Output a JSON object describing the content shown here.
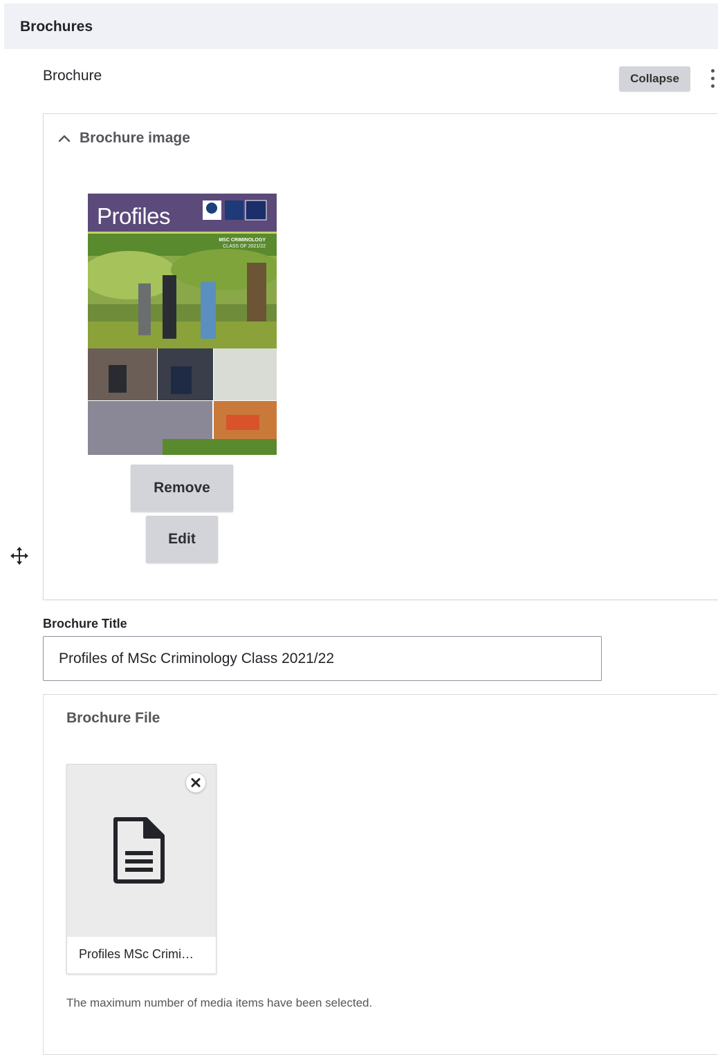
{
  "section": {
    "title": "Brochures"
  },
  "paragraph": {
    "label": "Brochure",
    "collapse_label": "Collapse"
  },
  "image_field": {
    "summary_label": "Brochure image",
    "thumbnail": {
      "title": "Profiles",
      "subtitle_line1": "MSC CRIMINOLOGY",
      "subtitle_line2": "CLASS OF 2021/22"
    },
    "remove_label": "Remove",
    "edit_label": "Edit"
  },
  "title_field": {
    "label": "Brochure Title",
    "value": "Profiles of MSc Criminology Class 2021/22"
  },
  "file_field": {
    "label": "Brochure File",
    "media_item_name": "Profiles MSc Crimi…",
    "note": "The maximum number of media items have been selected."
  },
  "icons": {
    "drag": "move-arrows-icon",
    "more": "kebab-menu-icon",
    "chevron": "chevron-up-icon",
    "remove_media": "close-icon",
    "document": "document-icon"
  },
  "colors": {
    "header_bg": "#f0f1f6",
    "button_bg": "#d3d4d9",
    "thumb_purple": "#5b4a7a",
    "thumb_green": "#5a8a2e"
  }
}
